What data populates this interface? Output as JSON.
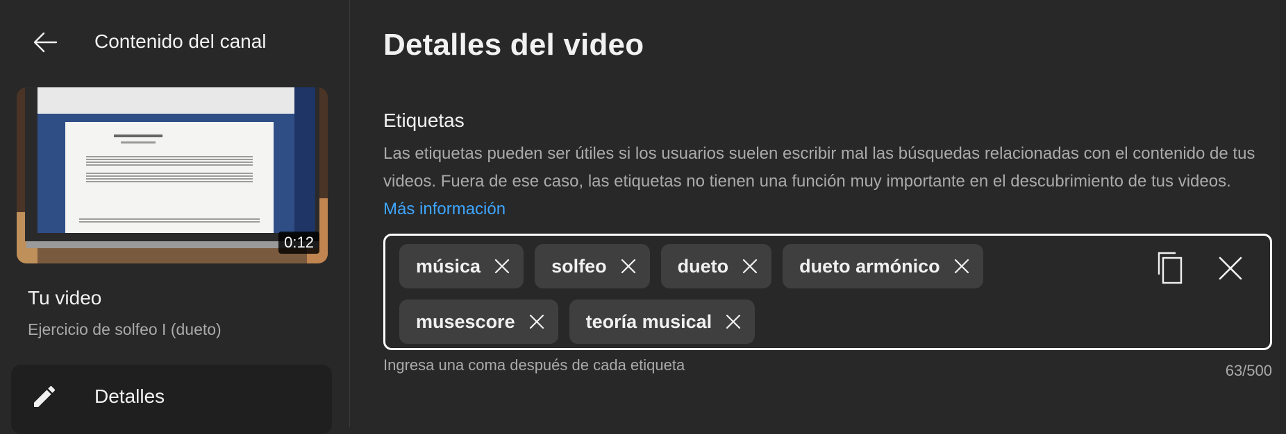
{
  "sidebar": {
    "title": "Contenido del canal",
    "thumbnail": {
      "duration": "0:12"
    },
    "your_video_label": "Tu video",
    "video_name": "Ejercicio de solfeo I (dueto)",
    "nav": [
      {
        "label": "Detalles",
        "icon": "pencil-icon",
        "active": true
      }
    ]
  },
  "main": {
    "page_title": "Detalles del video",
    "tags_section": {
      "label": "Etiquetas",
      "description": "Las etiquetas pueden ser útiles si los usuarios suelen escribir mal las búsquedas relacionadas con el contenido de tus videos. Fuera de ese caso, las etiquetas no tienen una función muy importante en el descubrimiento de tus videos.",
      "learn_more": "Más información",
      "tags": [
        "música",
        "solfeo",
        "dueto",
        "dueto armónico",
        "musescore",
        "teoría musical"
      ],
      "hint": "Ingresa una coma después de cada etiqueta",
      "counter": "63/500"
    }
  },
  "colors": {
    "background": "#282828",
    "chip": "#3f3f3f",
    "link": "#3ea6ff",
    "secondary_text": "#aaaaaa"
  }
}
